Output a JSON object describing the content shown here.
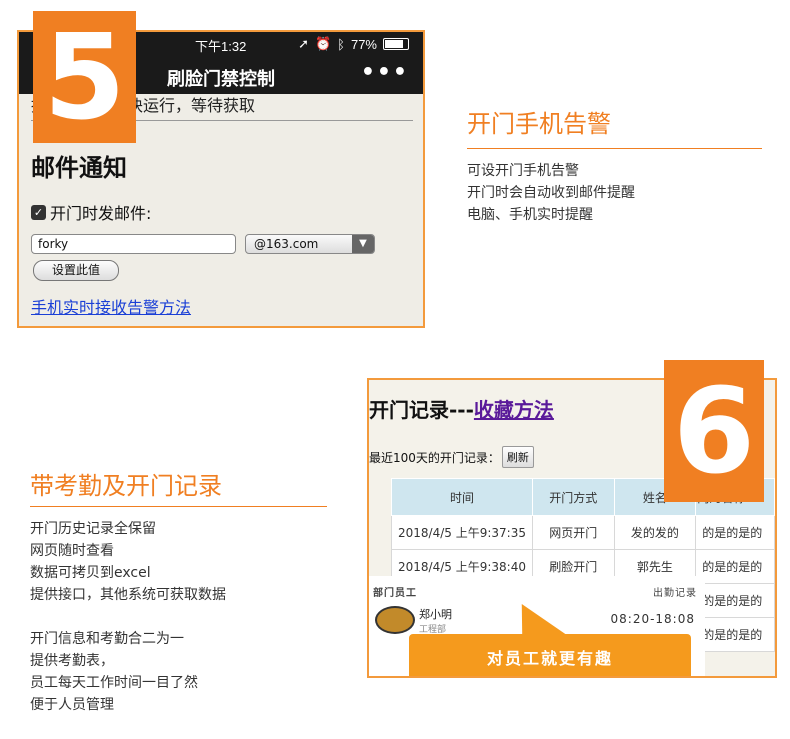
{
  "section5": {
    "badge_number": "5",
    "phone": {
      "status_time": "下午1:32",
      "battery": "77%",
      "nav_back": "‹",
      "nav_title": "刷脸门禁控制",
      "nav_more": "•••",
      "scroll_text": "提示：开门模块运行，等待获取",
      "mail_title": "邮件通知",
      "checkbox_label": "开门时发邮件:",
      "checkbox_checked": true,
      "email_value": "forky",
      "domain_value": "@163.com",
      "set_button": "设置此值",
      "help_link": "手机实时接收告警方法"
    },
    "heading": "开门手机告警",
    "lines": [
      "可设开门手机告警",
      "开门时会自动收到邮件提醒",
      "电脑、手机实时提醒"
    ]
  },
  "section6": {
    "badge_number": "6",
    "heading": "带考勤及开门记录",
    "lines_a": [
      "开门历史记录全保留",
      "网页随时查看",
      "数据可拷贝到excel",
      "提供接口，其他系统可获取数据"
    ],
    "lines_b": [
      "开门信息和考勤合二为一",
      "提供考勤表，",
      "员工每天工作时间一目了然",
      "便于人员管理"
    ],
    "web": {
      "title_prefix": "开门记录---",
      "title_link": "收藏方法",
      "recent_label": "最近100天的开门记录：",
      "refresh_button": "刷新",
      "columns": [
        "时间",
        "开门方式",
        "姓名",
        "门的名称"
      ],
      "rows": [
        [
          "2018/4/5 上午9:37:35",
          "网页开门",
          "发的发的",
          "的是的是的"
        ],
        [
          "2018/4/5 上午9:38:40",
          "刷脸开门",
          "郭先生",
          "的是的是的"
        ],
        [
          "",
          "",
          "",
          "的是的是的"
        ],
        [
          "",
          "",
          "",
          "的是的是的"
        ]
      ],
      "overlay": {
        "left_header": "部门员工",
        "right_header": "出勤记录",
        "name": "郑小明",
        "dept": "工程部",
        "time": "08:20-18:08",
        "callout": "对员工就更有趣"
      }
    }
  }
}
